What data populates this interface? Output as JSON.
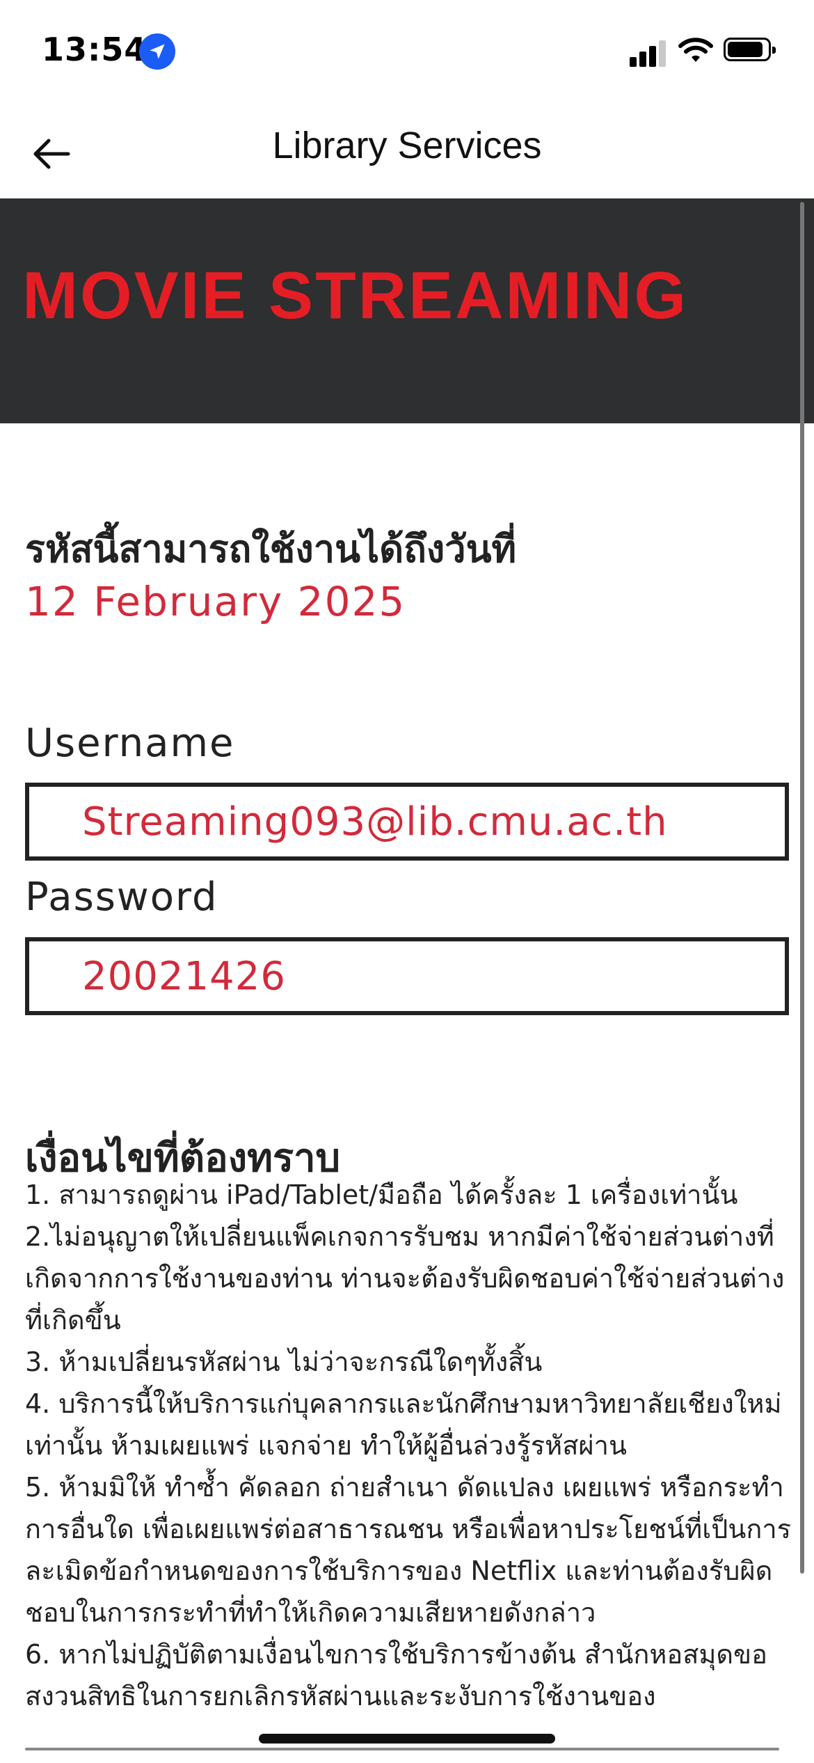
{
  "status_bar": {
    "time": "13:54",
    "icons": [
      "location-arrow-icon",
      "cellular-signal-icon",
      "wifi-icon",
      "battery-icon"
    ]
  },
  "header": {
    "back_icon": "arrow-left-icon",
    "title": "Library Services"
  },
  "banner": {
    "title": "MOVIE STREAMING",
    "background": "#2d2f30",
    "title_color": "#e51e25"
  },
  "expiry": {
    "label": "รหัสนี้สามารถใช้งานได้ถึงวันที่",
    "date": "12 February 2025"
  },
  "credentials": {
    "username_label": "Username",
    "username_value": "Streaming093@lib.cmu.ac.th",
    "password_label": "Password",
    "password_value": "20021426"
  },
  "conditions": {
    "title": "เงื่อนไขที่ต้องทราบ",
    "items": [
      "1. สามารถดูผ่าน iPad/Tablet/มือถือ ได้ครั้งละ 1 เครื่องเท่านั้น",
      "2.ไม่อนุญาตให้เปลี่ยนแพ็คเกจการรับชม หากมีค่าใช้จ่ายส่วนต่างที่เกิดจากการใช้งานของท่าน ท่านจะต้องรับผิดชอบค่าใช้จ่ายส่วนต่างที่เกิดขึ้น",
      "3. ห้ามเปลี่ยนรหัสผ่าน ไม่ว่าจะกรณีใดๆทั้งสิ้น",
      "4. บริการนี้ให้บริการแก่บุคลากรและนักศึกษามหาวิทยาลัยเชียงใหม่เท่านั้น ห้ามเผยแพร่ แจกจ่าย ทำให้ผู้อื่นล่วงรู้รหัสผ่าน",
      "5. ห้ามมิให้ ทำซ้ำ คัดลอก ถ่ายสำเนา ดัดแปลง เผยแพร่ หรือกระทำการอื่นใด เพื่อเผยแพร่ต่อสาธารณชน หรือเพื่อหาประโยชน์ที่เป็นการละเมิดข้อกำหนดของการใช้บริการของ Netflix และท่านต้องรับผิดชอบในการกระทำที่ทำให้เกิดความเสียหายดังกล่าว",
      "6. หากไม่ปฏิบัติตามเงื่อนไขการใช้บริการข้างต้น สำนักหอสมุดขอสงวนสิทธิในการยกเลิกรหัสผ่านและระงับการใช้งานของ"
    ]
  },
  "colors": {
    "accent_red": "#d22a3b",
    "text_dark": "#222222"
  }
}
